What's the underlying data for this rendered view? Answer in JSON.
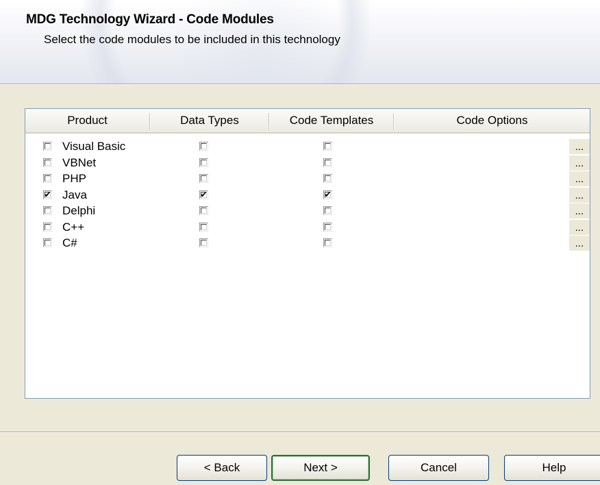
{
  "header": {
    "title": "MDG Technology Wizard - Code Modules",
    "subtitle": "Select the code modules to be included in this technology"
  },
  "grid": {
    "columns": [
      "Product",
      "Data Types",
      "Code Templates",
      "Code Options"
    ],
    "options_button_label": "...",
    "rows": [
      {
        "product": "Visual Basic",
        "product_checked": false,
        "data_types_checked": false,
        "code_templates_checked": false
      },
      {
        "product": "VBNet",
        "product_checked": false,
        "data_types_checked": false,
        "code_templates_checked": false
      },
      {
        "product": "PHP",
        "product_checked": false,
        "data_types_checked": false,
        "code_templates_checked": false
      },
      {
        "product": "Java",
        "product_checked": true,
        "data_types_checked": true,
        "code_templates_checked": true
      },
      {
        "product": "Delphi",
        "product_checked": false,
        "data_types_checked": false,
        "code_templates_checked": false
      },
      {
        "product": "C++",
        "product_checked": false,
        "data_types_checked": false,
        "code_templates_checked": false
      },
      {
        "product": "C#",
        "product_checked": false,
        "data_types_checked": false,
        "code_templates_checked": false
      }
    ]
  },
  "buttons": {
    "back": "< Back",
    "next": "Next >",
    "cancel": "Cancel",
    "help": "Help"
  },
  "colors": {
    "dialog_background": "#ece9d8",
    "grid_border": "#7f9db9",
    "default_button_border": "#2f6d3c"
  }
}
